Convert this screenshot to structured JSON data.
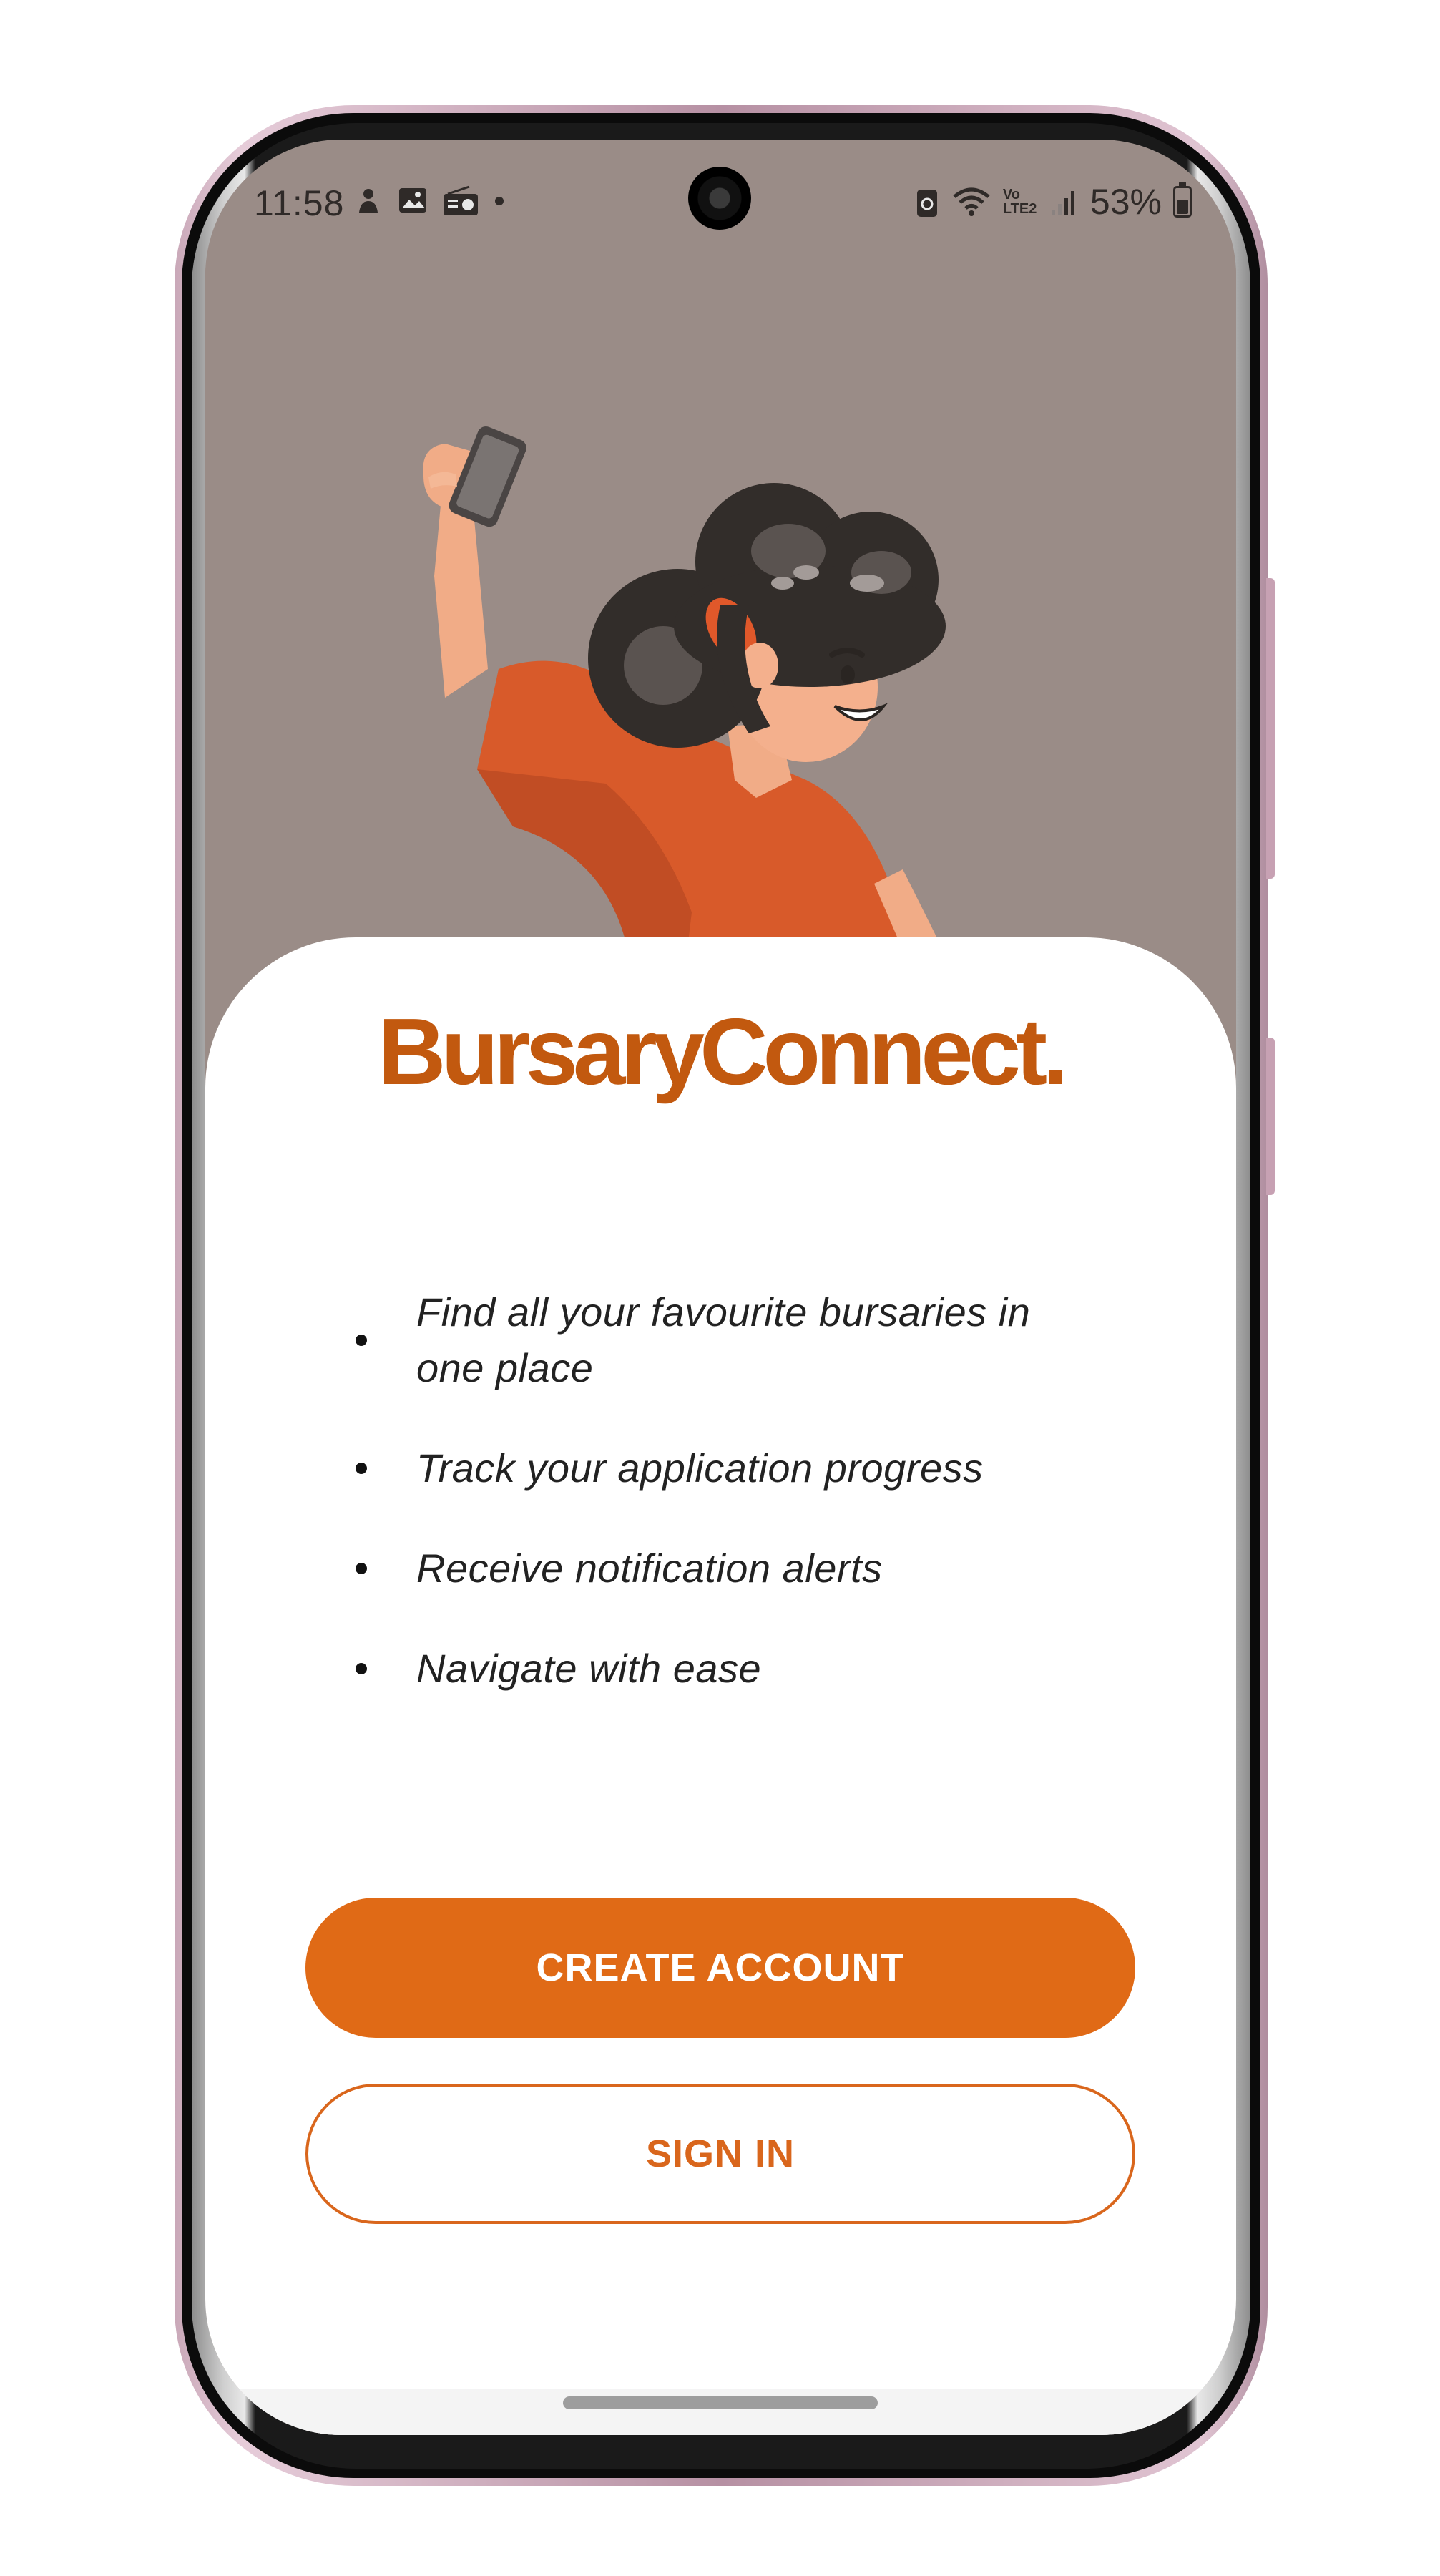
{
  "status_bar": {
    "time": "11:58",
    "battery_percent": "53%",
    "network_label": "Vo LTE2",
    "left_icons": [
      "notification-icon",
      "gallery-icon",
      "radio-icon",
      "more-dot-icon"
    ],
    "right_icons": [
      "battery-saver-icon",
      "wifi-icon",
      "volte-icon",
      "signal-icon",
      "battery-icon"
    ],
    "battery_level": 0.53
  },
  "hero": {
    "illustration": "woman-holding-phone-illustration",
    "background_color": "#9a8c87"
  },
  "app": {
    "brand_name": "BursaryConnect.",
    "brand_color": "#c2590f",
    "features": [
      "Find all your favourite bursaries in one place",
      "Track your application progress",
      "Receive notification alerts",
      "Navigate with ease"
    ],
    "create_account_label": "CREATE ACCOUNT",
    "sign_in_label": "SIGN IN",
    "accent_color": "#e06a16"
  }
}
